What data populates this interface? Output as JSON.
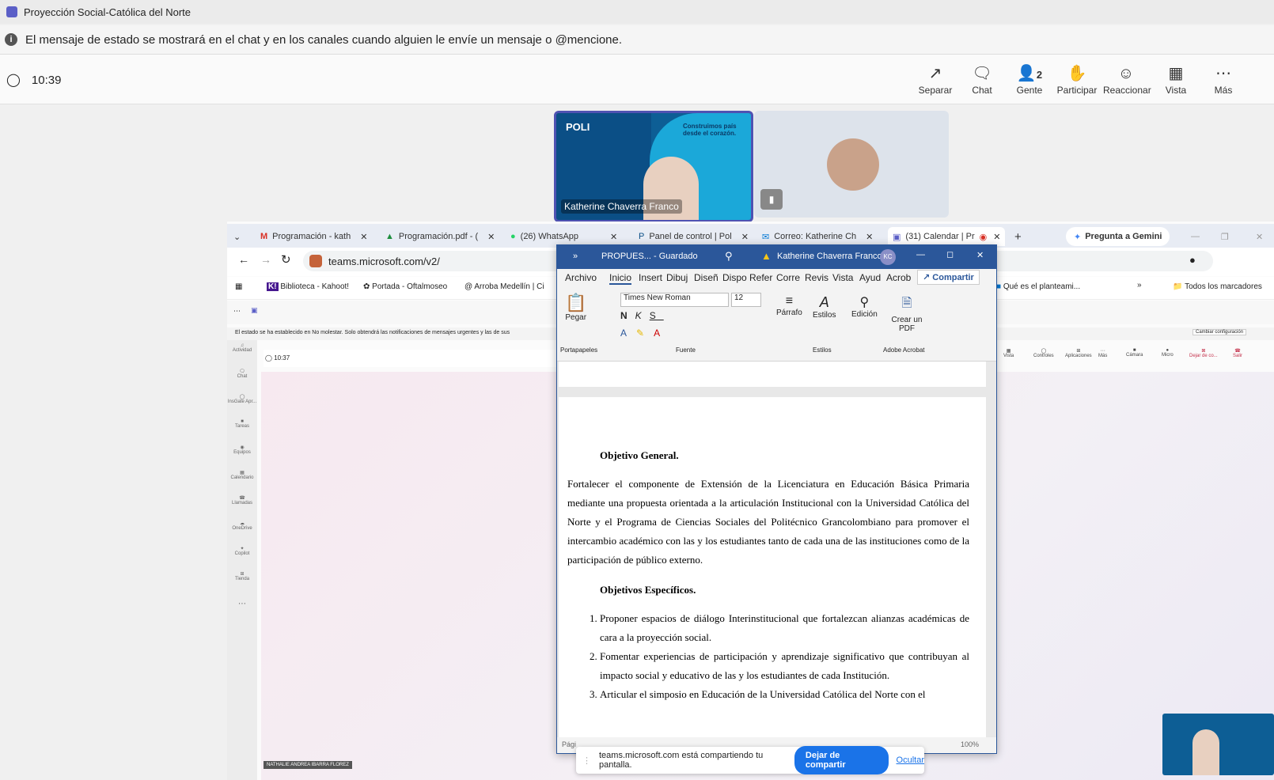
{
  "window": {
    "title": "Proyección Social-Católica del Norte"
  },
  "status_notice": "El mensaje de estado se mostrará en el chat y en los canales cuando alguien le envíe un mensaje o @mencione.",
  "meeting": {
    "time": "10:39",
    "tools": [
      {
        "label": "Separar",
        "icon": "pop-out-icon"
      },
      {
        "label": "Chat",
        "icon": "chat-icon"
      },
      {
        "label": "Gente",
        "icon": "people-icon",
        "badge": "2"
      },
      {
        "label": "Participar",
        "icon": "raise-hand-icon"
      },
      {
        "label": "Reaccionar",
        "icon": "smiley-icon"
      },
      {
        "label": "Vista",
        "icon": "view-icon"
      },
      {
        "label": "Más",
        "icon": "more-icon"
      }
    ]
  },
  "participants": [
    {
      "name": "Katherine Chaverra Franco",
      "slide_text": "Construimos país desde el corazón.",
      "logo": "POLI"
    },
    {
      "name": ""
    }
  ],
  "browser": {
    "tabs": [
      {
        "label": "Programación - kath",
        "icon": "gmail-icon"
      },
      {
        "label": "Programación.pdf - (",
        "icon": "drive-icon"
      },
      {
        "label": "(26) WhatsApp",
        "icon": "whatsapp-icon"
      },
      {
        "label": "Panel de control | Pol",
        "icon": "poli-icon"
      },
      {
        "label": "Correo: Katherine Ch",
        "icon": "outlook-icon"
      },
      {
        "label": "(31) Calendar | Pr",
        "icon": "teams-icon"
      }
    ],
    "gemini": "Pregunta a Gemini",
    "url": "teams.microsoft.com/v2/",
    "bookmarks": [
      "Biblioteca - Kahoot!",
      "Portada - Oftalmoseo",
      "Arroba Medellín | Ci",
      "Qué es el planteami...",
      "Todos los marcadores"
    ],
    "teams_notice": "El estado se ha establecido en No molestar. Solo obtendrá las notificaciones de mensajes urgentes y las de sus",
    "teams_notice_btn": "Cambiar configuración",
    "inner_time": "10:37",
    "inner_tools": [
      "Vista",
      "Controles",
      "Aplicaciones",
      "Más",
      "Cámara",
      "Micro",
      "Dejar de co...",
      "Salir"
    ],
    "rail": [
      "Actividad",
      "Chat",
      "InsGate Apr...",
      "Tareas",
      "Equipos",
      "Calendario",
      "Llamadas",
      "OneDrive",
      "Copilot",
      "Tienda"
    ],
    "presenter_label": "NATHALIE ANDREA IBARRA FLOREZ"
  },
  "word": {
    "doc_title": "PROPUES... - Guardado",
    "user": "Katherine Chaverra Franco",
    "initials": "KC",
    "tabs": [
      "Archivo",
      "Inicio",
      "Insert",
      "Dibuj",
      "Diseñ",
      "Dispo",
      "Refer",
      "Corre",
      "Revis",
      "Vista",
      "Ayud",
      "Acrob"
    ],
    "share_label": "Compartir",
    "font_name": "Times New Roman",
    "font_size": "12",
    "ribbon": {
      "paste": "Pegar",
      "paragraph": "Párrafo",
      "styles": "Estilos",
      "editing": "Edición",
      "pdf": "Crear un PDF",
      "groups": [
        "Portapapeles",
        "Fuente",
        "Estilos",
        "Adobe Acrobat"
      ]
    },
    "doc": {
      "heading1": "Objetivo General.",
      "para1": "Fortalecer el componente de Extensión de la Licenciatura en Educación Básica Primaria mediante una propuesta orientada a la articulación Institucional con la Universidad Católica del Norte y el Programa de Ciencias Sociales del Politécnico Grancolombiano para promover el intercambio académico con las y los estudiantes tanto de cada una de las instituciones como de la participación de público externo.",
      "heading2": "Objetivos Específicos.",
      "items": [
        "Proponer espacios de diálogo Interinstitucional que fortalezcan alianzas académicas de cara a la proyección social.",
        "Fomentar experiencias de participación y aprendizaje significativo que contribuyan al impacto social y educativo de las y los estudiantes de cada Institución.",
        "Articular el simposio  en Educación de la Universidad Católica del Norte con el"
      ]
    },
    "status_left": "Pági",
    "zoom": "100%"
  },
  "share_bar": {
    "text": "teams.microsoft.com está compartiendo tu pantalla.",
    "stop": "Dejar de compartir",
    "hide": "Ocultar"
  },
  "colors": {
    "teams_purple": "#5b5fc7",
    "word_blue": "#2b579a",
    "share_blue": "#1a73e8"
  }
}
